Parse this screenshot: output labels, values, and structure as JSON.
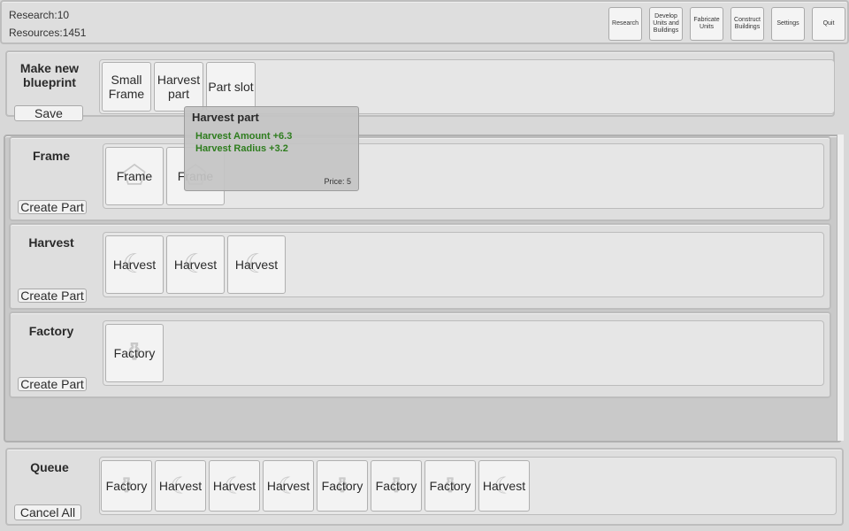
{
  "status": {
    "research_label": "Research:10",
    "resources_label": "Resources:1451"
  },
  "top_menu": {
    "research": "Research",
    "develop": "Develop Units and Buildings",
    "fabricate": "Fabricate Units",
    "construct": "Construct Buildings",
    "settings": "Settings",
    "quit": "Quit"
  },
  "blueprint": {
    "title": "Make new blueprint",
    "save": "Save",
    "slots": [
      "Small Frame",
      "Harvest part",
      "Part slot"
    ]
  },
  "tooltip": {
    "title": "Harvest part",
    "stats": [
      "Harvest Amount +6.3",
      "Harvest Radius +3.2"
    ],
    "price": "Price: 5",
    "stat_color": "#2e7d1e"
  },
  "categories": [
    {
      "title": "Frame",
      "create": "Create Part",
      "parts": [
        "Frame",
        "Frame"
      ]
    },
    {
      "title": "Harvest",
      "create": "Create Part",
      "parts": [
        "Harvest",
        "Harvest",
        "Harvest"
      ]
    },
    {
      "title": "Factory",
      "create": "Create Part",
      "parts": [
        "Factory"
      ]
    }
  ],
  "queue": {
    "title": "Queue",
    "cancel": "Cancel All",
    "items": [
      "Factory",
      "Harvest",
      "Harvest",
      "Harvest",
      "Factory",
      "Factory",
      "Factory",
      "Harvest"
    ]
  },
  "icons": {
    "frame": "frame-icon",
    "harvest": "scythe-icon",
    "factory": "factory-icon"
  }
}
